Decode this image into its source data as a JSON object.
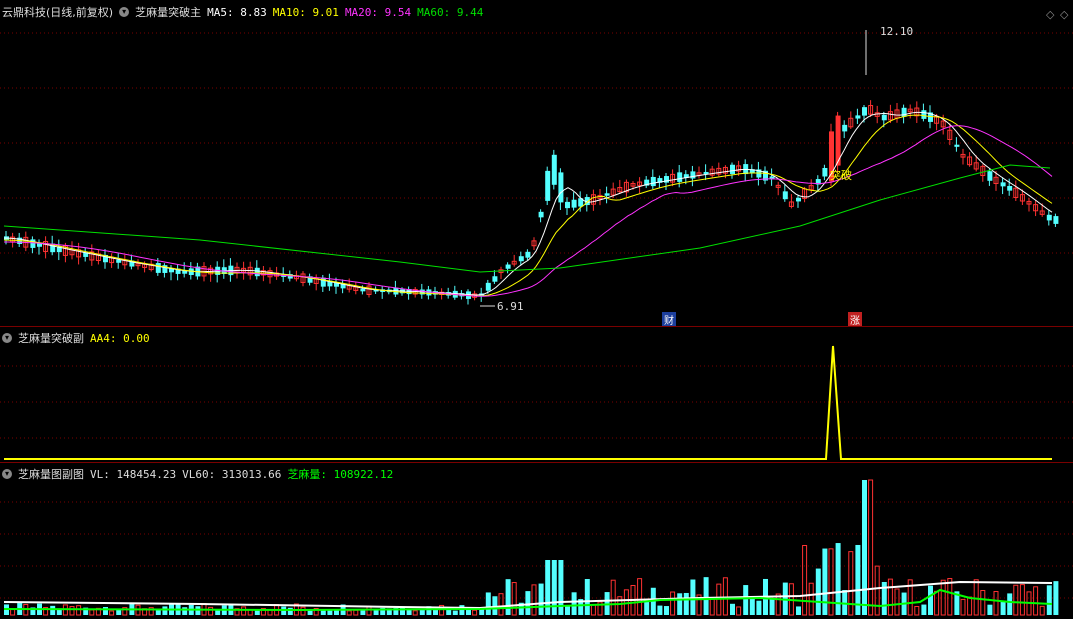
{
  "main_panel": {
    "stock_name": "云鼎科技(日线,前复权)",
    "indicator_name": "芝麻量突破主",
    "ma5_label": "MA5: 8.83",
    "ma10_label": "MA10: 9.01",
    "ma20_label": "MA20: 9.54",
    "ma60_label": "MA60: 9.44",
    "high_label": "12.10",
    "low_label": "6.91",
    "breakout_label": "突破",
    "cai_label": "财",
    "zhang_label": "涨"
  },
  "sub_panel_1": {
    "indicator_name": "芝麻量突破副",
    "aa4_label": "AA4: 0.00"
  },
  "sub_panel_2": {
    "indicator_name": "芝麻量图副图",
    "vl_label": "VL: 148454.23",
    "vl60_label": "VL60: 313013.66",
    "zml_label": "芝麻量: 108922.12"
  },
  "colors": {
    "up": "#ff3232",
    "down": "#54ffff",
    "ma5": "#ffffff",
    "ma10": "#ffff00",
    "ma20": "#ff33ff",
    "ma60": "#00e000",
    "grid": "#7a0000",
    "volume_line": "#ffffff",
    "zml_line": "#00ff00"
  },
  "chart_data": {
    "type": "candlestick",
    "high": 12.1,
    "low": 6.91
  }
}
